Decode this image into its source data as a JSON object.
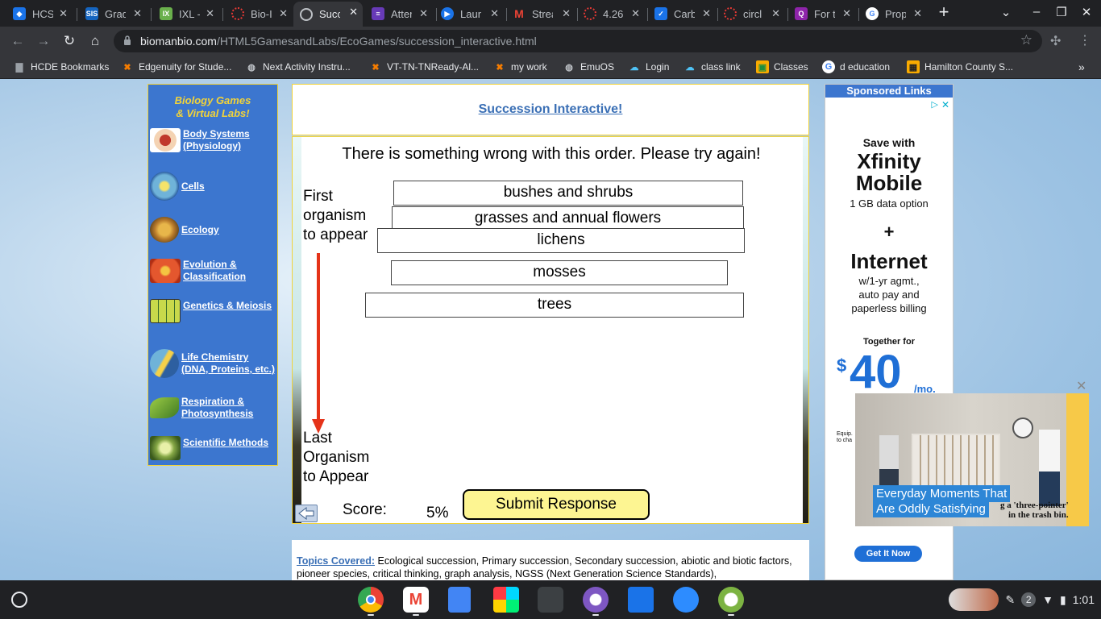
{
  "browser": {
    "tabs": [
      {
        "title": "HCS",
        "icon": "hcs-icon",
        "color": "#1a73e8"
      },
      {
        "title": "Grad",
        "icon": "sis-icon",
        "color": "#1565c0"
      },
      {
        "title": "IXL -",
        "icon": "ixl-icon",
        "color": "#6ab04c"
      },
      {
        "title": "Bio-I",
        "icon": "circle-dots-icon",
        "color": "#e53935"
      },
      {
        "title": "Succ",
        "icon": "globe-icon",
        "color": "#9aa0a6"
      },
      {
        "title": "Atter",
        "icon": "form-icon",
        "color": "#673ab7"
      },
      {
        "title": "Laun",
        "icon": "meet-icon",
        "color": "#1a73e8"
      },
      {
        "title": "Strea",
        "icon": "gmail-icon",
        "color": "#ea4335"
      },
      {
        "title": "4.26",
        "icon": "circle-dots-icon",
        "color": "#e53935"
      },
      {
        "title": "Carb",
        "icon": "check-icon",
        "color": "#1a73e8"
      },
      {
        "title": "circl",
        "icon": "circle-dots-icon",
        "color": "#e53935"
      },
      {
        "title": "For t",
        "icon": "q-icon",
        "color": "#8e24aa"
      },
      {
        "title": "Prop",
        "icon": "google-icon",
        "color": "#4285f4"
      }
    ],
    "url_domain": "biomanbio.com",
    "url_path": "/HTML5GamesandLabs/EcoGames/succession_interactive.html",
    "bookmarks": [
      {
        "label": "HCDE Bookmarks",
        "icon": "folder-icon"
      },
      {
        "label": "Edgenuity for Stude...",
        "icon": "edgenuity-icon"
      },
      {
        "label": "Next Activity Instru...",
        "icon": "globe-icon"
      },
      {
        "label": "VT-TN-TNReady-Al...",
        "icon": "edgenuity-icon"
      },
      {
        "label": "my work",
        "icon": "edgenuity-icon"
      },
      {
        "label": "EmuOS",
        "icon": "globe-icon"
      },
      {
        "label": "Login",
        "icon": "cloud-icon"
      },
      {
        "label": "class link",
        "icon": "cloud-icon"
      },
      {
        "label": "Classes",
        "icon": "classroom-icon"
      },
      {
        "label": "d education",
        "icon": "google-icon"
      },
      {
        "label": "Hamilton County S...",
        "icon": "calendar-icon"
      }
    ]
  },
  "sidebar": {
    "heading_line1": "Biology Games",
    "heading_line2": "& Virtual Labs!",
    "items": [
      {
        "label_line1": "Body Systems",
        "label_line2": "(Physiology)"
      },
      {
        "label_line1": "Cells",
        "label_line2": ""
      },
      {
        "label_line1": "Ecology",
        "label_line2": ""
      },
      {
        "label_line1": "Evolution &",
        "label_line2": "Classification"
      },
      {
        "label_line1": "Genetics & Meiosis",
        "label_line2": ""
      },
      {
        "label_line1": "Life Chemistry",
        "label_line2": "(DNA, Proteins, etc.)"
      },
      {
        "label_line1": "Respiration &",
        "label_line2": "Photosynthesis"
      },
      {
        "label_line1": "Scientific Methods",
        "label_line2": ""
      }
    ]
  },
  "page_title": "Succession Interactive!",
  "game": {
    "feedback": "There is something wrong with this order.  Please try again!",
    "first_label_1": "First",
    "first_label_2": "organism",
    "first_label_3": "to appear",
    "last_label_1": "Last",
    "last_label_2": "Organism",
    "last_label_3": "to Appear",
    "organisms": [
      "bushes and shrubs",
      "grasses and annual flowers",
      "lichens",
      "mosses",
      "trees"
    ],
    "score_label": "Score:",
    "score_value": "5%",
    "submit_label": "Submit Response"
  },
  "topics": {
    "label": "Topics Covered:",
    "text": " Ecological succession, Primary succession, Secondary succession, abiotic and biotic factors, pioneer species, critical thinking, graph analysis, NGSS (Next Generation Science Standards),"
  },
  "ad": {
    "sponsored": "Sponsored Links",
    "save_with": "Save with",
    "brand_1": "Xfinity",
    "brand_2": "Mobile",
    "data_option": "1 GB data option",
    "plus": "+",
    "internet": "Internet",
    "terms_1": "w/1-yr agmt.,",
    "terms_2": "auto pay and",
    "terms_3": "paperless billing",
    "together": "Together for",
    "dollar": "$",
    "price": "40",
    "per": "/mo.",
    "fine_1": "Equip.",
    "fine_2": "to cha",
    "cta": "Get It Now"
  },
  "video": {
    "caption_1": "Everyday Moments That",
    "caption_2": "Are Oddly Satisfying",
    "subtitle_1": "g a 'three-pointer'",
    "subtitle_2": "in the trash bin."
  },
  "shelf": {
    "notifications": "2",
    "time": "1:01"
  }
}
